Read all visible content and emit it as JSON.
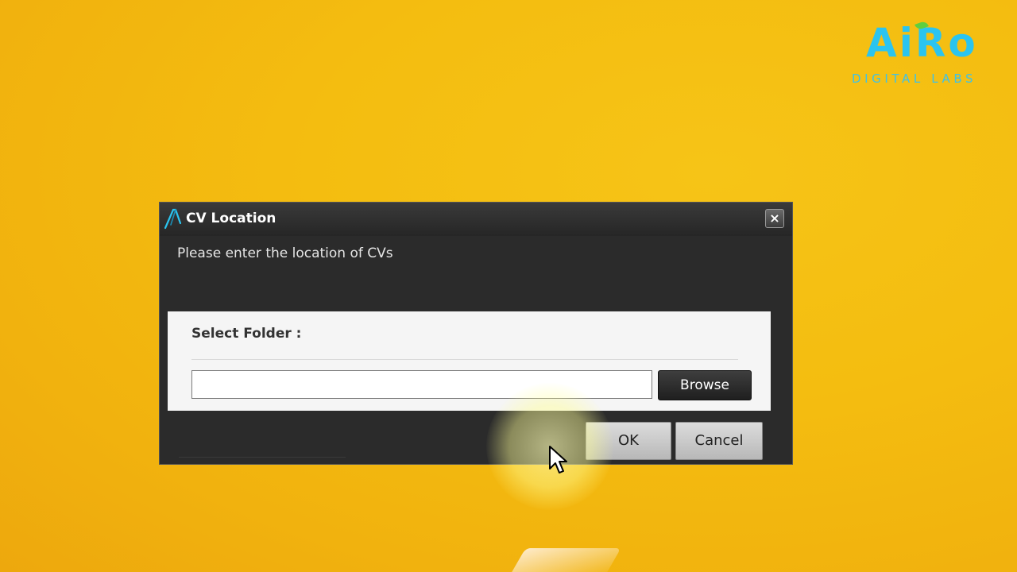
{
  "logo": {
    "word": "AiRo",
    "subtitle": "DIGITAL LABS"
  },
  "dialog": {
    "title": "CV Location",
    "close_label": "×",
    "prompt": "Please enter the location of CVs",
    "select_folder_label": "Select Folder :",
    "folder_input_value": "",
    "browse_label": "Browse",
    "ok_label": "OK",
    "cancel_label": "Cancel"
  },
  "colors": {
    "desktop_background": "#f4bd10",
    "dialog_background": "#2b2b2b",
    "logo_accent": "#2bc4ef",
    "logo_leaf": "#5fcf3f"
  },
  "icons": {
    "app": "app-logo-icon",
    "close": "close-icon",
    "cursor": "mouse-pointer-icon"
  }
}
